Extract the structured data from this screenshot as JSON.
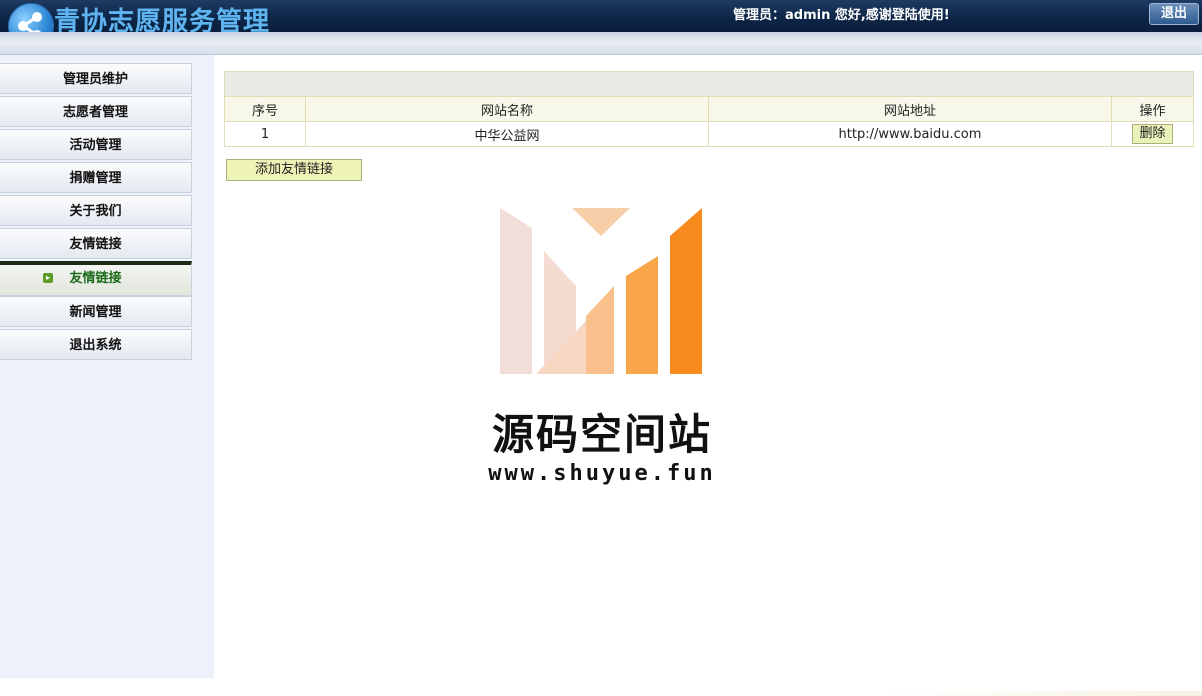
{
  "header": {
    "title": "青协志愿服务管理",
    "welcome": "管理员：admin 您好,感谢登陆使用!",
    "logout_label": "退出"
  },
  "sidebar": {
    "items": [
      {
        "label": "管理员维护"
      },
      {
        "label": "志愿者管理"
      },
      {
        "label": "活动管理"
      },
      {
        "label": "捐赠管理"
      },
      {
        "label": "关于我们"
      },
      {
        "label": "友情链接"
      },
      {
        "label": "友情链接",
        "active": true
      },
      {
        "label": "新闻管理"
      },
      {
        "label": "退出系统"
      }
    ]
  },
  "main": {
    "table": {
      "columns": [
        "序号",
        "网站名称",
        "网站地址",
        "操作"
      ],
      "rows": [
        {
          "index": "1",
          "name": "中华公益网",
          "url": "http://www.baidu.com",
          "action": "删除"
        }
      ]
    },
    "add_button": "添加友情链接"
  },
  "watermark": {
    "title": "源码空间站",
    "url": "www.shuyue.fun"
  },
  "colors": {
    "header_dark": "#0c2446",
    "title_blue": "#5fb4f0",
    "sidebar_bg": "#eef2fb",
    "active_text": "#1a6a1a",
    "button_yellow": "#eef3b7",
    "watermark_orange": "#f68a1c"
  }
}
